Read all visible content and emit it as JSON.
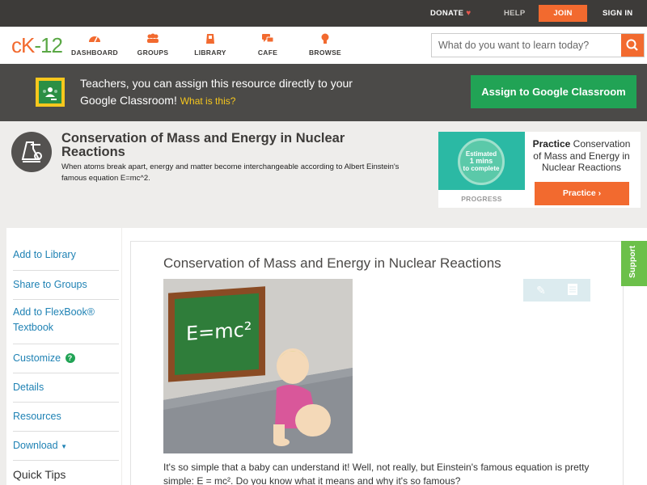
{
  "topbar": {
    "donate": "DONATE",
    "help": "HELP",
    "join": "JOIN",
    "signin": "SIGN IN"
  },
  "logo": {
    "ck": "cK",
    "dash": "-",
    "num": "12"
  },
  "nav": {
    "dashboard": "DASHBOARD",
    "groups": "GROUPS",
    "library": "LIBRARY",
    "cafe": "CAFE",
    "browse": "BROWSE"
  },
  "search": {
    "placeholder": "What do you want to learn today?"
  },
  "google_banner": {
    "text": "Teachers, you can assign this resource directly to your Google Classroom!",
    "what_link": "What is this?",
    "assign_button": "Assign to Google Classroom"
  },
  "concept": {
    "title": "Conservation of Mass and Energy in Nuclear Reactions",
    "description": "When atoms break apart, energy and matter become interchangeable according to Albert Einstein's famous equation E=mc^2."
  },
  "practice": {
    "estimate_line1": "Estimated",
    "estimate_line2": "1 mins",
    "estimate_line3": "to complete",
    "progress_label": "PROGRESS",
    "heading_bold": "Practice",
    "heading_rest": "Conservation of Mass and Energy in Nuclear Reactions",
    "button": "Practice"
  },
  "sidebar": {
    "add_library": "Add to Library",
    "share_groups": "Share to Groups",
    "add_flexbook": "Add to FlexBook® Textbook",
    "customize": "Customize",
    "details": "Details",
    "resources": "Resources",
    "download": "Download",
    "quick_tips": "Quick Tips"
  },
  "article": {
    "title": "Conservation of Mass and Energy in Nuclear Reactions",
    "board_text": "E=mc²",
    "intro": "It's so simple that a baby can understand it! Well, not really, but Einstein's famous equation is pretty simple: E = mc². Do you know what it means and why it's so famous?"
  },
  "support": "Support",
  "colors": {
    "accent": "#f26a2f",
    "green": "#21a355",
    "link": "#1f82b4",
    "dark": "#3d3b39"
  }
}
